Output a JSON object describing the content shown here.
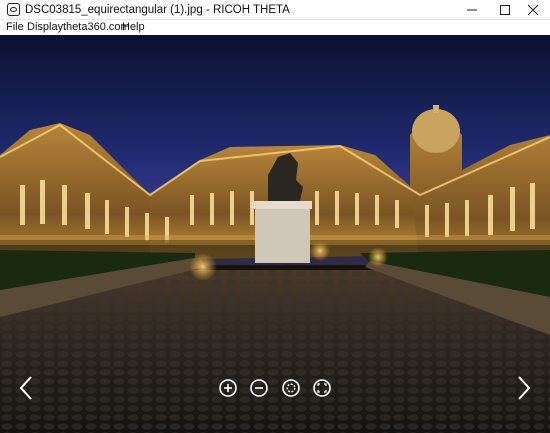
{
  "window": {
    "title": "DSC03815_equirectangular (1).jpg - RICOH THETA",
    "minimize_icon": "minimize-icon",
    "maximize_icon": "maximize-icon",
    "close_icon": "close-icon"
  },
  "menu": {
    "items": [
      "File",
      "Display",
      "theta360.com",
      "Help"
    ]
  },
  "viewer": {
    "controls": {
      "prev": "chevron-left-icon",
      "next": "chevron-right-icon",
      "zoom_in": "zoom-in-icon",
      "zoom_out": "zoom-out-icon",
      "rotate": "auto-rotate-icon",
      "fullscreen": "fullscreen-icon"
    },
    "colors": {
      "sky_top": "#0b1030",
      "sky_bottom": "#3a3f9a",
      "building_light": "#d9a441",
      "ground": "#2a2520"
    }
  }
}
